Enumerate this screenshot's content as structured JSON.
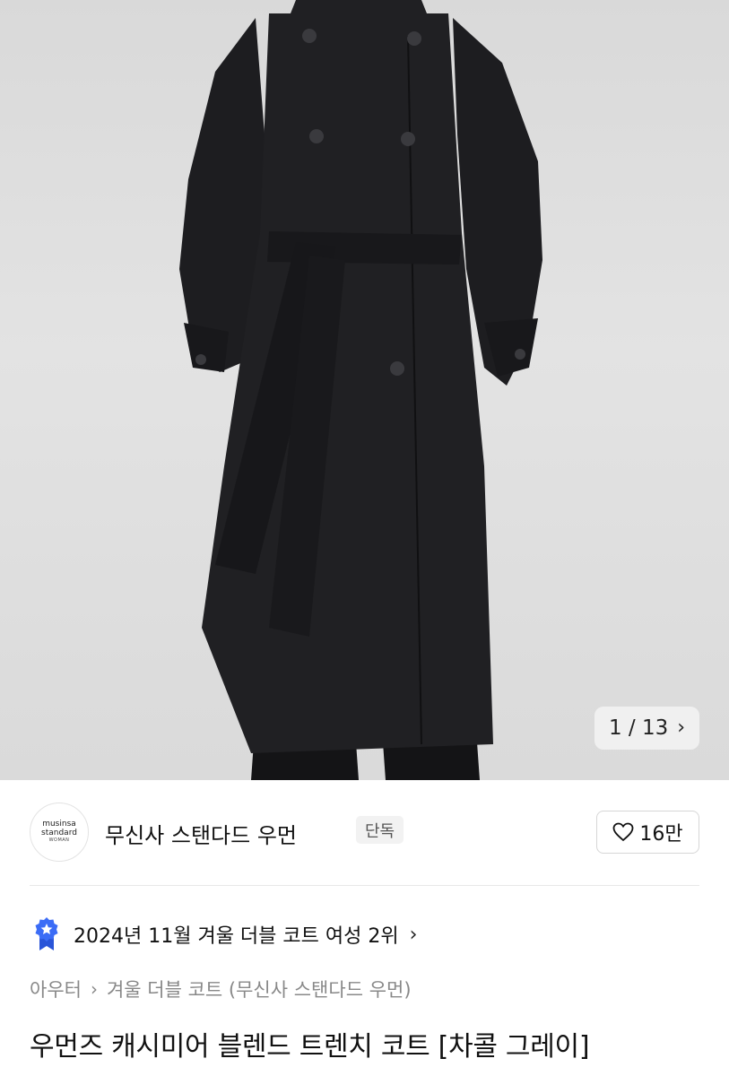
{
  "gallery": {
    "image_alt": "charcoal gray double-breasted belted long coat",
    "pager": {
      "current": "1",
      "separator": "/",
      "total": "13",
      "next_icon": "chevron-right-icon"
    }
  },
  "brand": {
    "logo_line1": "musinsa",
    "logo_line2": "standard",
    "logo_line3": "WOMAN",
    "name": "무신사 스탠다드 우먼",
    "badge": "단독",
    "like_count": "16만",
    "like_icon": "heart-outline-icon"
  },
  "ranking": {
    "icon": "blue-star-badge-icon",
    "text": "2024년 11월 겨울 더블 코트 여성 2위",
    "chevron": "chevron-right-icon"
  },
  "breadcrumb": {
    "items": [
      "아우터",
      "겨울 더블 코트 (무신사 스탠다드 우먼)"
    ]
  },
  "product": {
    "title": "우먼즈 캐시미어 블렌드 트렌치 코트 [차콜 그레이]"
  },
  "colors": {
    "accent_blue": "#3b6cf6",
    "coat": "#1c1c1e",
    "background": "#dcdcdc"
  }
}
